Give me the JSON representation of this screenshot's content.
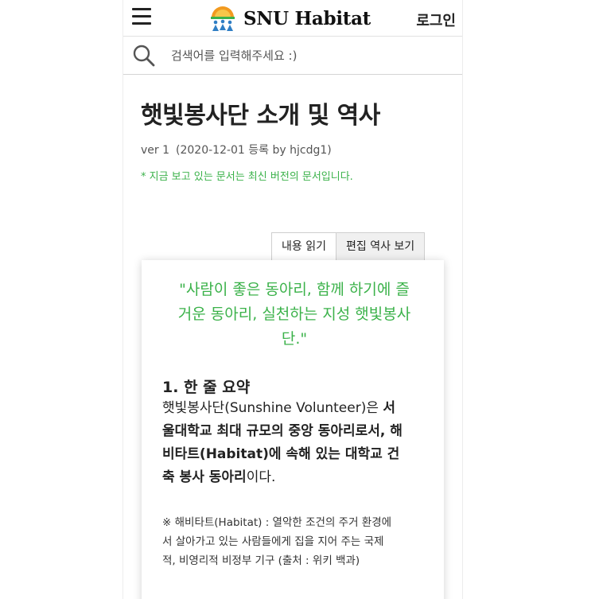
{
  "header": {
    "brand": "SNU Habitat",
    "login_label": "로그인"
  },
  "search": {
    "placeholder": "검색어를 입력해주세요 :)"
  },
  "document": {
    "title": "햇빛봉사단 소개 및 역사",
    "version": "ver 1",
    "registered": "(2020-12-01 등록 by hjcdg1)",
    "notice": "* 지금 보고 있는 문서는 최신 버전의 문서입니다."
  },
  "tabs": [
    {
      "label": "내용 읽기",
      "active": true
    },
    {
      "label": "편집 역사 보기",
      "active": false
    }
  ],
  "content": {
    "quote_line1": "\"사람이 좋은 동아리, 함께 하기에 즐",
    "quote_line2": "거운 동아리, 실천하는 지성 햇빛봉사",
    "quote_line3": "단.\"",
    "section_heading": "1. 한 줄 요약",
    "summary_plain_start": "햇빛봉사단(Sunshine Volunteer)은 ",
    "summary_bold_1": "서",
    "summary_bold_2": "울대학교 최대 규모의 중앙 동아리로서, 해",
    "summary_bold_3": "비타트(Habitat)에 속해 있는 대학교 건",
    "summary_bold_4": "축 봉사 동아리",
    "summary_plain_end": "이다.",
    "footnote_line1": "※ 해비타트(Habitat) : 열악한 조건의 주거 환경에",
    "footnote_line2": "서 살아가고 있는 사람들에게 집을 지어 주는 국제",
    "footnote_line3": "적, 비영리적 비정부 기구 (출처 : 위키 백과)"
  },
  "colors": {
    "accent_green": "#3bb24a",
    "logo_orange": "#f29a1f",
    "logo_blue": "#2f7ec4"
  }
}
